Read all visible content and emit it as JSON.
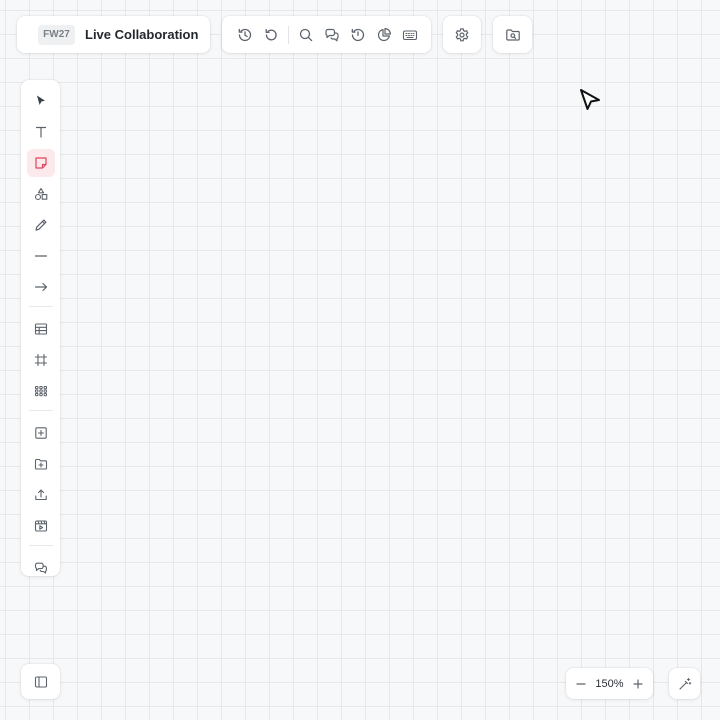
{
  "header": {
    "badge": "FW27",
    "title": "Live Collaboration"
  },
  "top_toolbar": {
    "icons": [
      "history-icon",
      "undo-icon",
      "search-icon",
      "comments-icon",
      "version-history-icon",
      "stats-icon",
      "keyboard-icon"
    ]
  },
  "side_toolbar": {
    "active_tool": "sticky-note",
    "tools": [
      "select",
      "text",
      "sticky-note",
      "shapes",
      "pen",
      "line",
      "arrow",
      "table",
      "frame",
      "grid",
      "add-item",
      "add-folder",
      "upload",
      "media",
      "comments"
    ]
  },
  "zoom": {
    "level": "150%"
  },
  "colors": {
    "accent": "#e0455d",
    "active_bg": "#fbe9ec",
    "icon": "#5d636c",
    "canvas_bg": "#f7f8fa",
    "grid_line": "#e6e8ec"
  }
}
